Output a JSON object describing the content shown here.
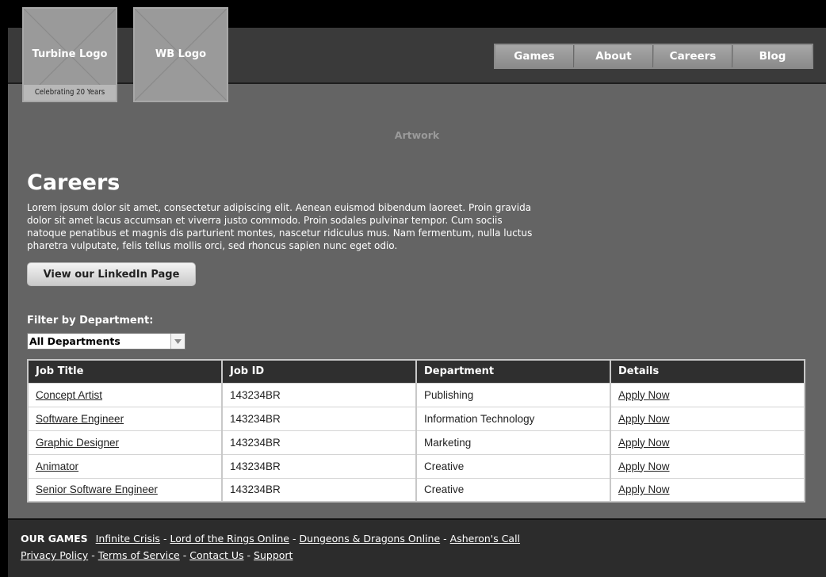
{
  "header": {
    "logos": [
      {
        "label": "Turbine Logo",
        "tagline": "Celebrating 20 Years"
      },
      {
        "label": "WB Logo"
      }
    ],
    "nav": [
      "Games",
      "About",
      "Careers",
      "Blog"
    ]
  },
  "artwork_label": "Artwork",
  "careers": {
    "title": "Careers",
    "intro": "Lorem ipsum dolor sit amet, consectetur adipiscing elit. Aenean euismod bibendum laoreet. Proin gravida dolor sit amet lacus accumsan et viverra justo commodo. Proin sodales pulvinar tempor. Cum sociis natoque penatibus et magnis dis parturient montes, nascetur ridiculus mus. Nam fermentum, nulla luctus pharetra vulputate, felis tellus mollis orci, sed rhoncus sapien nunc eget odio.",
    "linkedin_button": "View our LinkedIn Page"
  },
  "filter": {
    "label": "Filter by Department:",
    "selected": "All Departments"
  },
  "table": {
    "columns": [
      "Job Title",
      "Job ID",
      "Department",
      "Details"
    ],
    "rows": [
      {
        "title": "Concept Artist",
        "id": "143234BR",
        "department": "Publishing",
        "details": "Apply Now"
      },
      {
        "title": "Software Engineer",
        "id": "143234BR",
        "department": "Information Technology",
        "details": "Apply Now"
      },
      {
        "title": "Graphic Designer",
        "id": "143234BR",
        "department": "Marketing",
        "details": "Apply Now"
      },
      {
        "title": "Animator",
        "id": "143234BR",
        "department": "Creative",
        "details": "Apply Now"
      },
      {
        "title": "Senior Software Engineer",
        "id": "143234BR",
        "department": "Creative",
        "details": "Apply Now"
      }
    ]
  },
  "footer": {
    "games_label": "OUR GAMES",
    "games": [
      "Infinite Crisis",
      "Lord of the Rings Online",
      "Dungeons & Dragons Online",
      "Asheron's Call"
    ],
    "links": [
      "Privacy Policy",
      "Terms of Service",
      "Contact Us",
      "Support"
    ]
  }
}
